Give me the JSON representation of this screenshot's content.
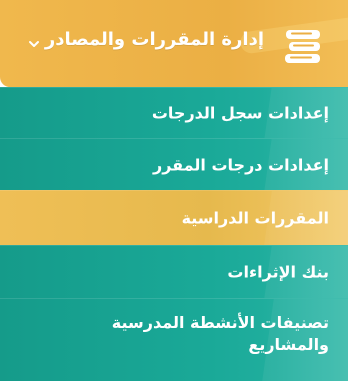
{
  "header": {
    "title": "إدارة المقررات والمصادر",
    "icon": "books-icon",
    "chevron": "chevron-down-icon",
    "accent": "#ebaf44"
  },
  "items": [
    {
      "label": "إعدادات سجل الدرجات",
      "color": "#1aa998"
    },
    {
      "label": "إعدادات درجات المقرر",
      "color": "#1aa998"
    },
    {
      "label": "المقررات الدراسية",
      "color": "#e6b94d"
    },
    {
      "label": "بنك الإثراءات",
      "color": "#1aa998"
    },
    {
      "label": "تصنيفات الأنشطة المدرسية والمشاريع",
      "color": "#1aa998"
    }
  ]
}
